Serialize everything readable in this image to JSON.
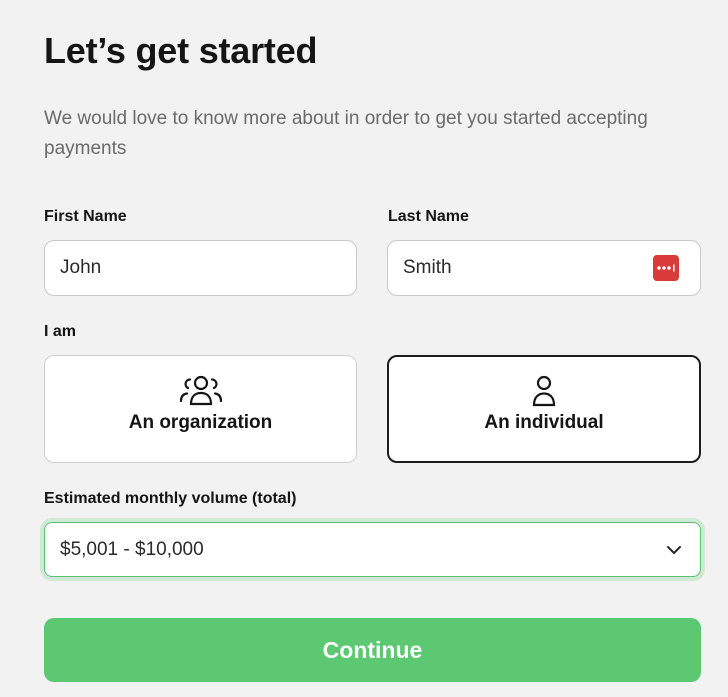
{
  "header": {
    "title": "Let’s get started",
    "subtitle": "We would love to know more about in order to get you started accepting payments"
  },
  "form": {
    "first_name": {
      "label": "First Name",
      "value": "John"
    },
    "last_name": {
      "label": "Last Name",
      "value": "Smith",
      "icon": "password-manager-icon"
    },
    "i_am": {
      "label": "I am",
      "options": [
        {
          "label": "An organization",
          "icon": "group-icon",
          "selected": false
        },
        {
          "label": "An individual",
          "icon": "person-icon",
          "selected": true
        }
      ]
    },
    "volume": {
      "label": "Estimated monthly volume (total)",
      "value": "$5,001 - $10,000",
      "icon": "chevron-down-icon"
    },
    "continue_label": "Continue"
  },
  "colors": {
    "accent": "#5cc872",
    "focus_ring": "#cfe9d4",
    "password_icon": "#d93a3a",
    "selected_border": "#1d1d1d"
  }
}
